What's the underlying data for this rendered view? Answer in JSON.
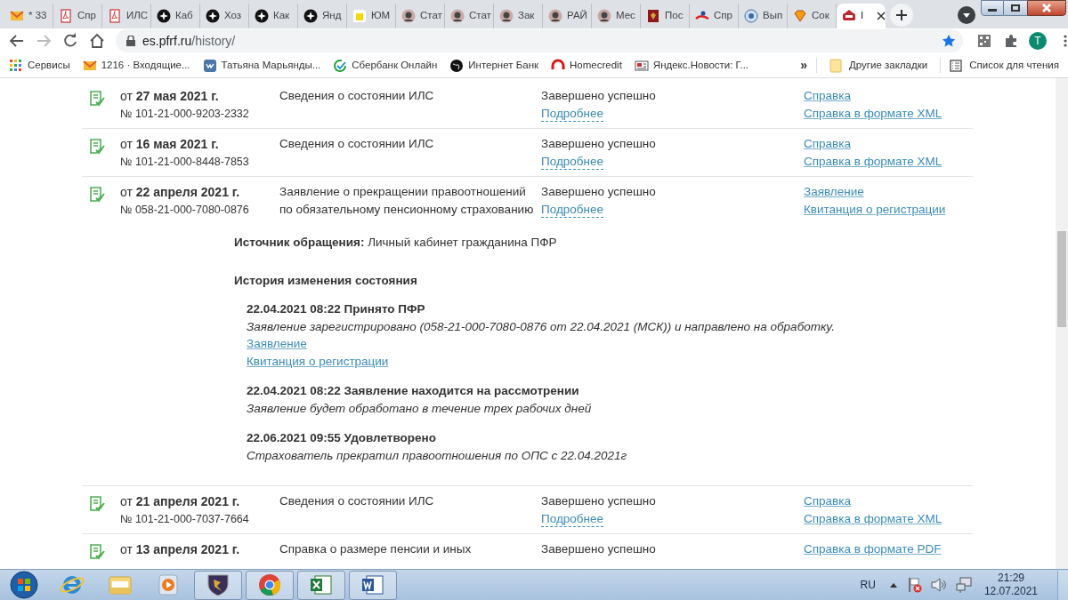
{
  "tabs": [
    {
      "title": "* 33",
      "kind": "mail",
      "selected": false
    },
    {
      "title": "Спр",
      "kind": "pdf",
      "selected": false
    },
    {
      "title": "ИЛС",
      "kind": "pdf",
      "selected": false
    },
    {
      "title": "Каб",
      "kind": "dark",
      "selected": false
    },
    {
      "title": "Хоз",
      "kind": "dark",
      "selected": false
    },
    {
      "title": "Как",
      "kind": "dark",
      "selected": false
    },
    {
      "title": "Янд",
      "kind": "dark",
      "selected": false
    },
    {
      "title": "ЮМ",
      "kind": "yellow",
      "selected": false
    },
    {
      "title": "Стат",
      "kind": "avatar",
      "selected": false
    },
    {
      "title": "Стат",
      "kind": "avatar",
      "selected": false
    },
    {
      "title": "Зак",
      "kind": "avatar",
      "selected": false
    },
    {
      "title": "РАЙ",
      "kind": "avatar",
      "selected": false
    },
    {
      "title": "Мес",
      "kind": "avatar",
      "selected": false
    },
    {
      "title": "Пос",
      "kind": "crest",
      "selected": false
    },
    {
      "title": "Спр",
      "kind": "mark",
      "selected": false
    },
    {
      "title": "Вып",
      "kind": "globe",
      "selected": false
    },
    {
      "title": "Сок",
      "kind": "gem",
      "selected": false
    },
    {
      "title": "I",
      "kind": "logo",
      "selected": true
    }
  ],
  "address": {
    "host": "es.pfrf.ru",
    "path": "/history/"
  },
  "profile": "T",
  "bookmarks": [
    {
      "label": "Сервисы",
      "kind": "apps"
    },
    {
      "label": "1216 · Входящие...",
      "kind": "mail"
    },
    {
      "label": "Татьяна Марьянды...",
      "kind": "vk"
    },
    {
      "label": "Сбербанк Онлайн",
      "kind": "check"
    },
    {
      "label": "Интернет Банк",
      "kind": "dark"
    },
    {
      "label": "Homecredit",
      "kind": "ring"
    },
    {
      "label": "Яндекс.Новости: Г...",
      "kind": "news"
    }
  ],
  "bookmarks_more": "»",
  "other_bookmarks": "Другие закладки",
  "reading_list": "Список для чтения",
  "rows": [
    {
      "date": "от **27 мая 2021 г.**",
      "number": "№ 101-21-000-9203-2332",
      "description": "Сведения о состоянии ИЛС",
      "status": "Завершено успешно",
      "details": "Подробнее",
      "links": [
        "Справка",
        "Справка в формате XML"
      ]
    },
    {
      "date": "от **16 мая 2021 г.**",
      "number": "№ 101-21-000-8448-7853",
      "description": "Сведения о состоянии ИЛС",
      "status": "Завершено успешно",
      "details": "Подробнее",
      "links": [
        "Справка",
        "Справка в формате XML"
      ]
    },
    {
      "date": "от **22 апреля 2021 г.**",
      "number": "№ 058-21-000-7080-0876",
      "description": "Заявление о прекращении правоотношений по обязательному пенсионному страхованию",
      "status": "Завершено успешно",
      "details": "Подробнее",
      "links": [
        "Заявление",
        "Квитанция о регистрации"
      ],
      "expanded": true,
      "source": "**Источник обращения:** Личный кабинет гражданина ПФР",
      "history_title": "История изменения состояния",
      "history": [
        {
          "title": "22.04.2021 08:22 Принято ПФР",
          "note": "Заявление зарегистрировано (058-21-000-7080-0876 от 22.04.2021 (МСК)) и направлено на обработку.",
          "links": [
            "Заявление",
            "Квитанция о регистрации"
          ]
        },
        {
          "title": "22.04.2021 08:22 Заявление находится на рассмотрении",
          "note": "Заявление будет обработано в течение трех рабочих дней"
        },
        {
          "title": "22.06.2021 09:55 Удовлетворено",
          "note": "Страхователь прекратил правоотношения по ОПС с 22.04.2021г"
        }
      ]
    },
    {
      "date": "от **21 апреля 2021 г.**",
      "number": "№ 101-21-000-7037-7664",
      "description": "Сведения о состоянии ИЛС",
      "status": "Завершено успешно",
      "details": "Подробнее",
      "links": [
        "Справка",
        "Справка в формате XML"
      ]
    },
    {
      "date": "от **13 апреля 2021 г.**",
      "description": "Справка о размере пенсии и иных",
      "status": "Завершено успешно",
      "links": [
        "Справка в формате PDF"
      ]
    }
  ],
  "tray": {
    "language": "RU",
    "time": "21:29",
    "date": "12.07.2021"
  }
}
